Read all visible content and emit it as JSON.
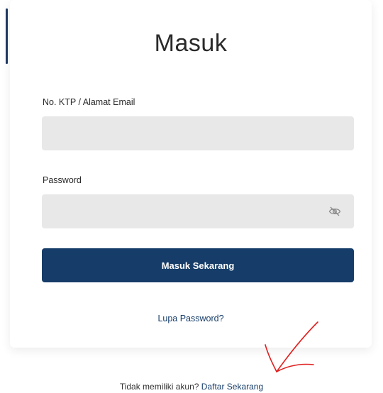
{
  "login": {
    "title": "Masuk",
    "email_label": "No. KTP / Alamat Email",
    "email_value": "",
    "password_label": "Password",
    "password_value": "",
    "password_toggle_icon": "eye-slash-icon",
    "submit_label": "Masuk Sekarang",
    "forgot_label": "Lupa Password?"
  },
  "signup": {
    "prompt": "Tidak memiliki akun?",
    "link_label": "Daftar Sekarang"
  },
  "colors": {
    "primary": "#163d69",
    "input_bg": "#e8e8e8",
    "annotation": "#e02020"
  }
}
